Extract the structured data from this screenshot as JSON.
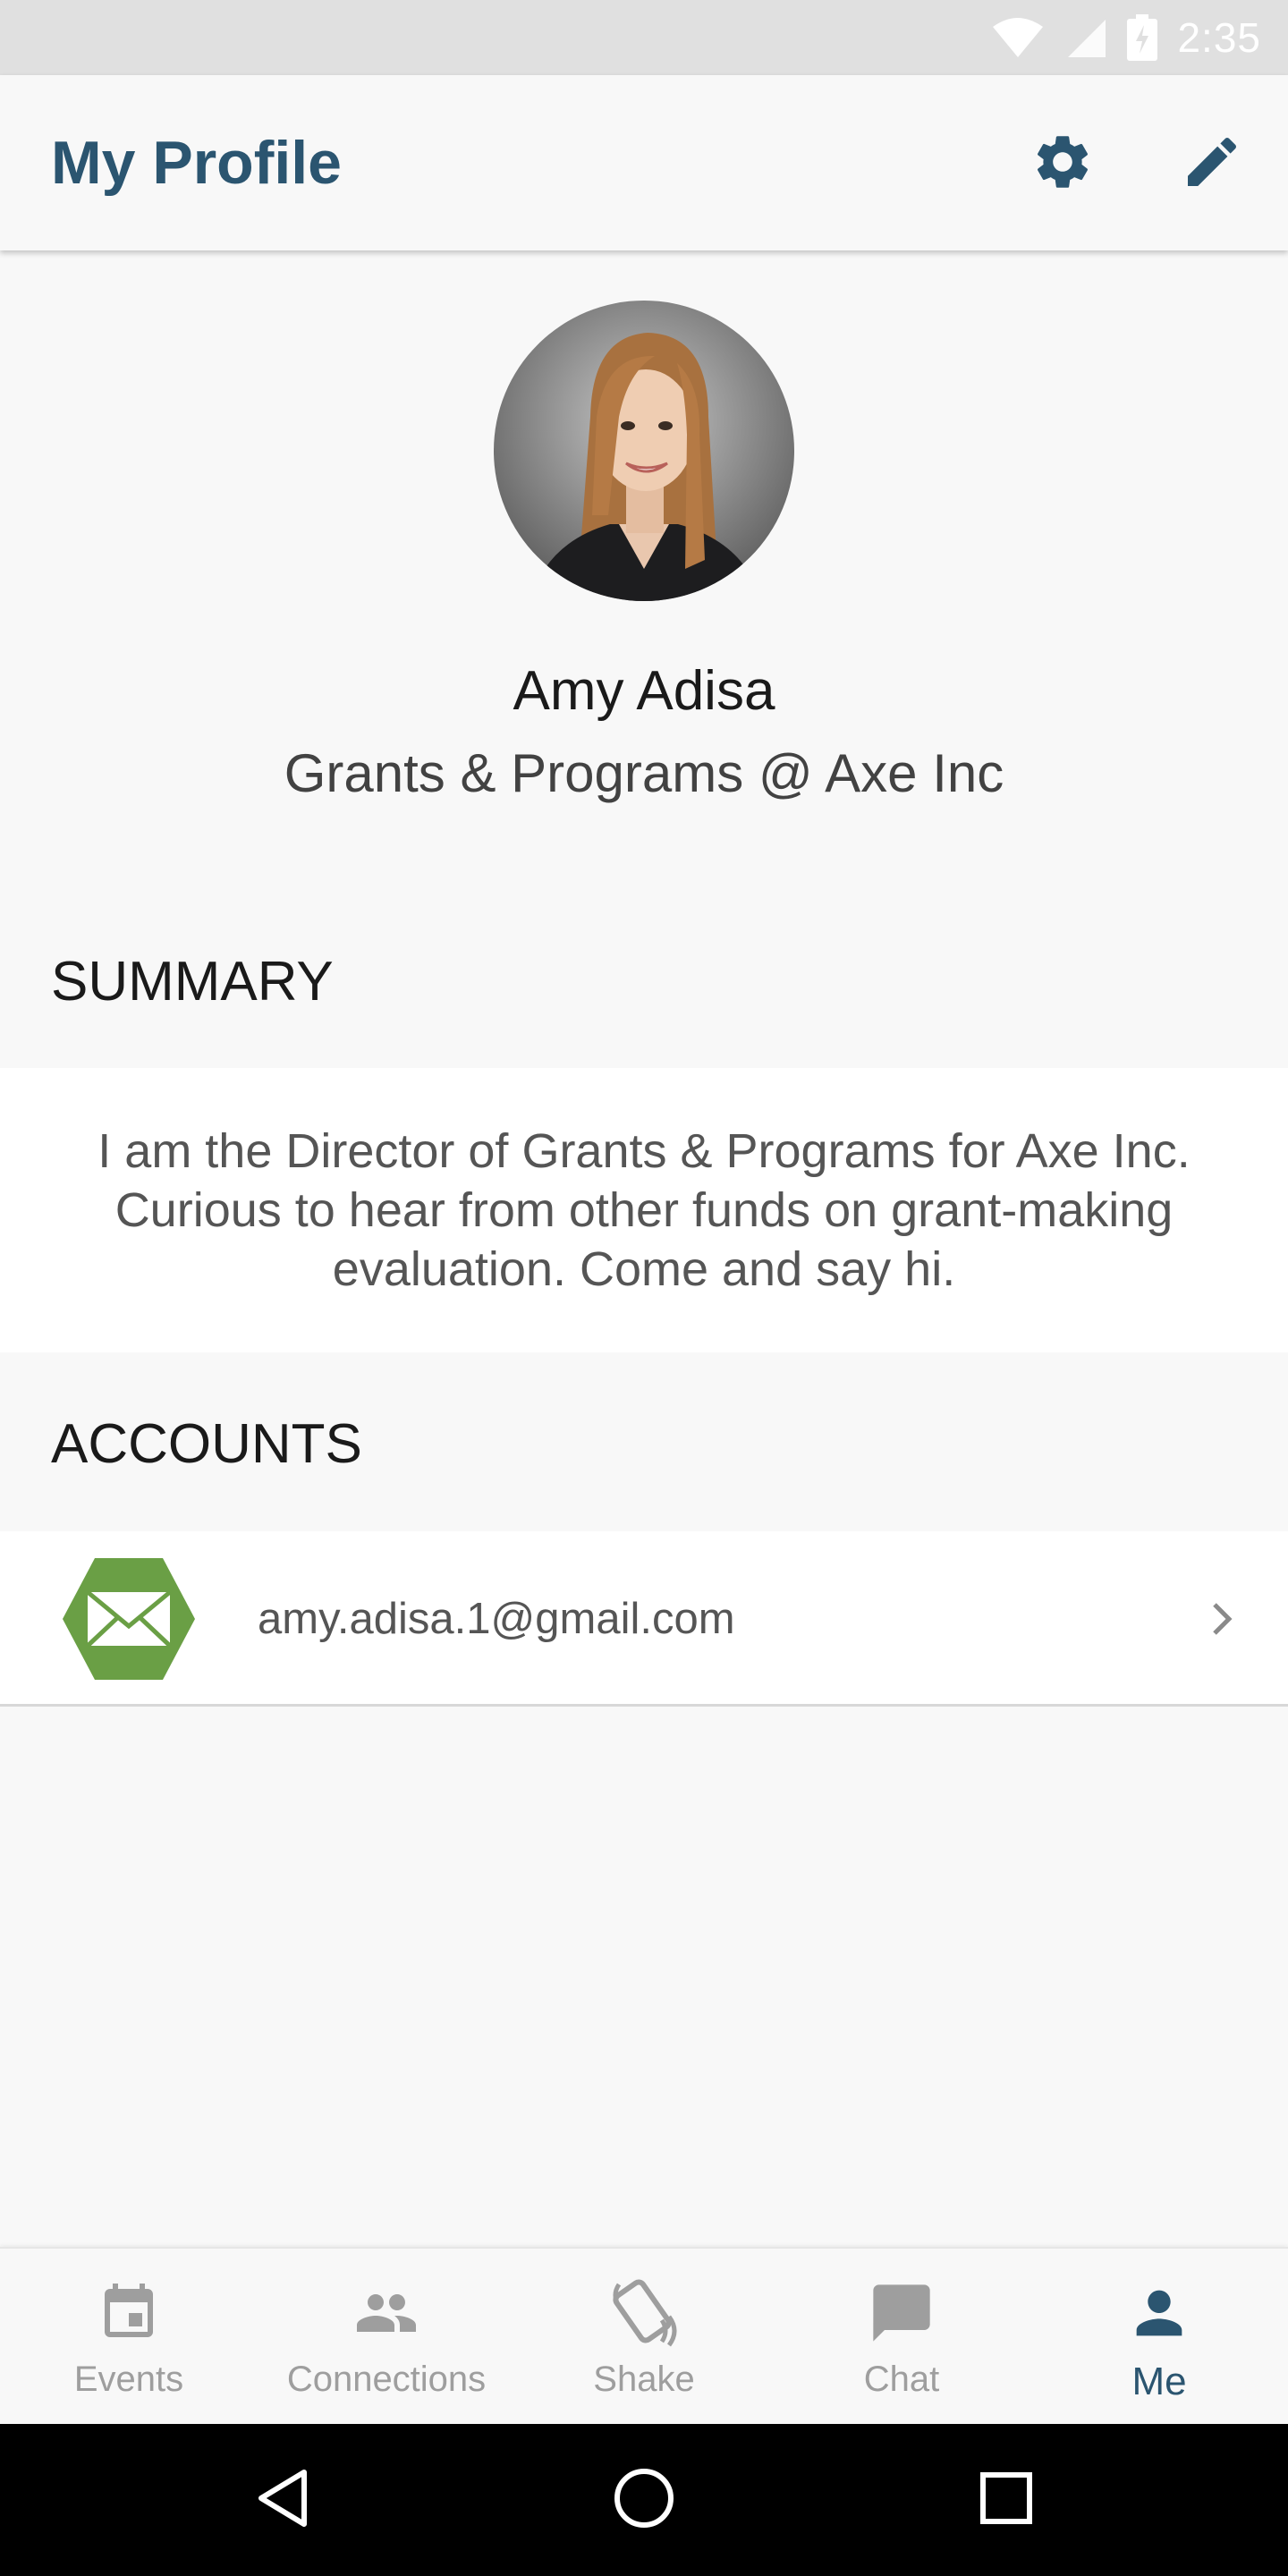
{
  "status_bar": {
    "time": "2:35"
  },
  "app_bar": {
    "title": "My Profile",
    "settings_icon": "gear-icon",
    "edit_icon": "pencil-icon"
  },
  "profile": {
    "name": "Amy Adisa",
    "title": "Grants & Programs @ Axe Inc"
  },
  "summary": {
    "header": "SUMMARY",
    "text": "I am the Director of Grants & Programs for Axe Inc. Curious to hear from other funds on grant-making evaluation. Come and say hi."
  },
  "accounts": {
    "header": "ACCOUNTS",
    "items": [
      {
        "icon": "mail-icon",
        "email": "amy.adisa.1@gmail.com"
      }
    ]
  },
  "bottom_nav": {
    "items": [
      {
        "label": "Events",
        "icon": "calendar-icon",
        "active": false
      },
      {
        "label": "Connections",
        "icon": "people-icon",
        "active": false
      },
      {
        "label": "Shake",
        "icon": "shake-phone-icon",
        "active": false
      },
      {
        "label": "Chat",
        "icon": "chat-bubble-icon",
        "active": false
      },
      {
        "label": "Me",
        "icon": "person-icon",
        "active": true
      }
    ]
  },
  "colors": {
    "accent": "#2b5570",
    "mail_green": "#6a9f45",
    "background": "#f8f8f8"
  }
}
